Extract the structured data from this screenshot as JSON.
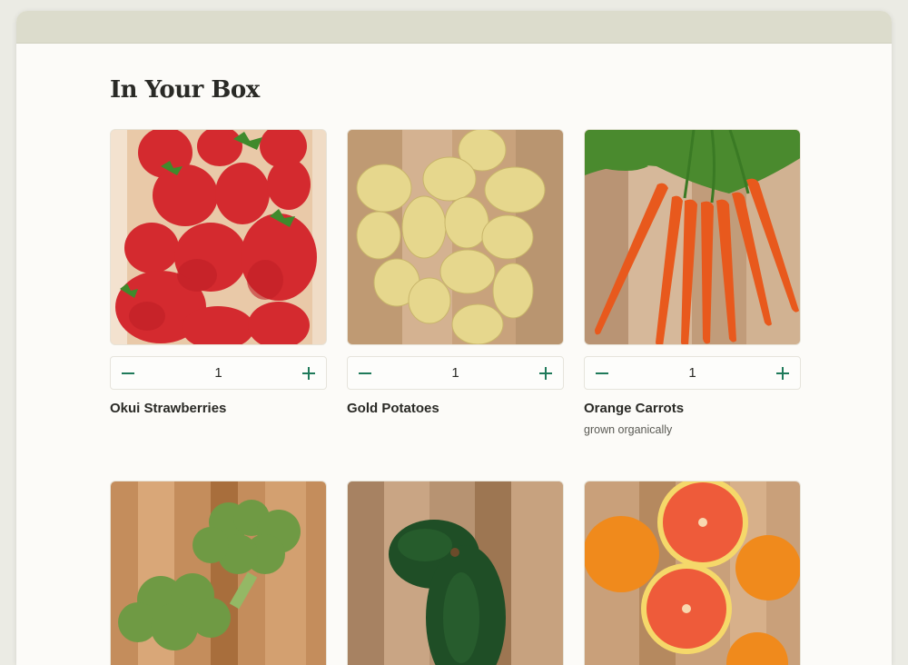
{
  "page": {
    "title": "In Your Box"
  },
  "items": [
    {
      "name": "Okui Strawberries",
      "quantity": "1",
      "note": "",
      "image": "strawberries"
    },
    {
      "name": "Gold Potatoes",
      "quantity": "1",
      "note": "",
      "image": "potatoes"
    },
    {
      "name": "Orange Carrots",
      "quantity": "1",
      "note": "grown organically",
      "image": "carrots"
    },
    {
      "name": "",
      "quantity": "",
      "note": "",
      "image": "broccoli"
    },
    {
      "name": "",
      "quantity": "",
      "note": "",
      "image": "avocado"
    },
    {
      "name": "",
      "quantity": "",
      "note": "",
      "image": "oranges"
    }
  ],
  "colors": {
    "accent": "#1f7a5a",
    "titlebar": "#dcdccc",
    "page_background": "#fcfbf8"
  },
  "icons": {
    "decrement": "minus-icon",
    "increment": "plus-icon"
  }
}
